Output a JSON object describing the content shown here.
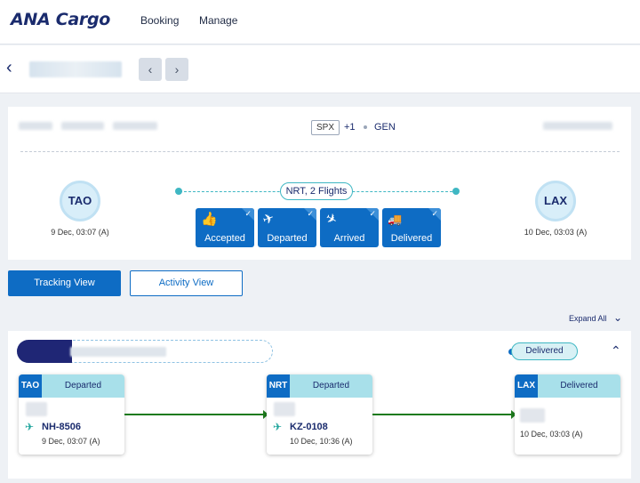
{
  "brand": {
    "logo": "ANA Cargo"
  },
  "nav": {
    "booking": "Booking",
    "manage": "Manage"
  },
  "pager": {
    "prev": "‹",
    "next": "›"
  },
  "shipment": {
    "product": "SPX",
    "extra": "+1",
    "handling": "GEN",
    "origin": {
      "code": "TAO",
      "date": "9 Dec, 03:07 (A)"
    },
    "destination": {
      "code": "LAX",
      "date": "10 Dec, 03:03 (A)"
    },
    "route": "NRT, 2 Flights",
    "statuses": [
      {
        "label": "Accepted",
        "icon": "thumbs-up-icon",
        "glyph": "👍"
      },
      {
        "label": "Departed",
        "icon": "plane-departure-icon",
        "glyph": "✈"
      },
      {
        "label": "Arrived",
        "icon": "plane-arrival-icon",
        "glyph": "✈"
      },
      {
        "label": "Delivered",
        "icon": "truck-icon",
        "glyph": "🚚"
      }
    ]
  },
  "views": {
    "tracking": "Tracking View",
    "activity": "Activity View"
  },
  "expand_all": "Expand All",
  "tracking": {
    "overall_status": "Delivered",
    "legs": [
      {
        "code": "TAO",
        "status": "Departed",
        "flight": "NH-8506",
        "time": "9 Dec, 03:07 (A)"
      },
      {
        "code": "NRT",
        "status": "Departed",
        "flight": "KZ-0108",
        "time": "10 Dec, 10:36 (A)"
      },
      {
        "code": "LAX",
        "status": "Delivered",
        "flight": "",
        "time": "10 Dec, 03:03 (A)"
      }
    ]
  },
  "colors": {
    "primary": "#0e6cc4",
    "brand": "#1a2b6d",
    "accent": "#3fb7c3"
  }
}
